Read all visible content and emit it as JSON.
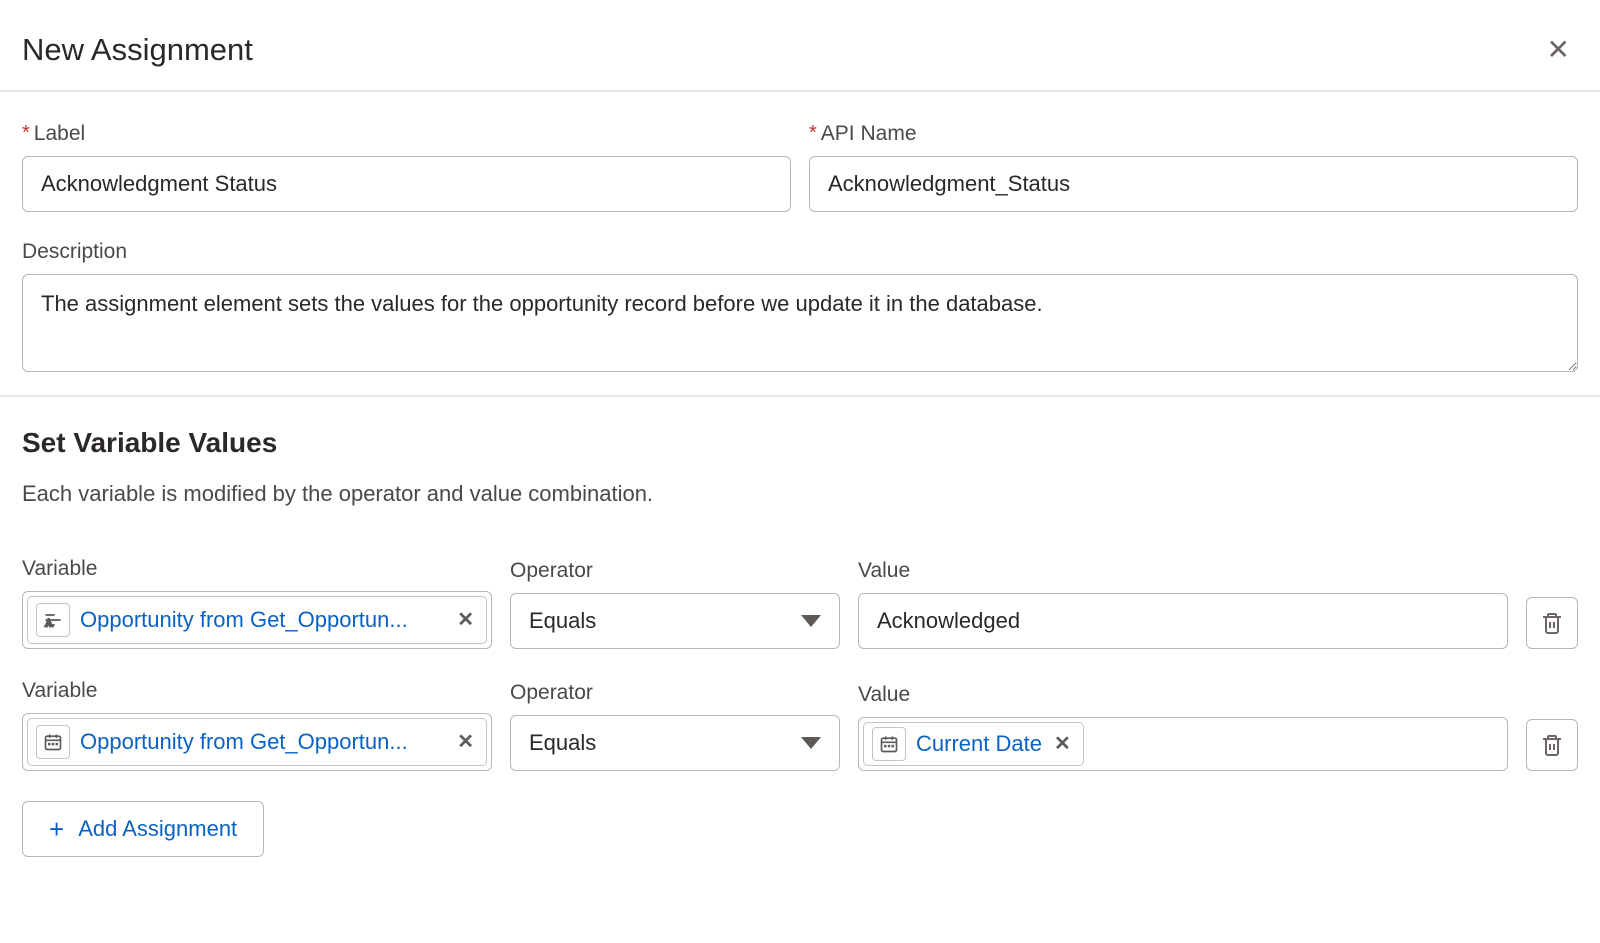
{
  "header": {
    "title": "New Assignment"
  },
  "fields": {
    "label_field": {
      "label": "Label",
      "value": "Acknowledgment Status"
    },
    "api_name_field": {
      "label": "API Name",
      "value": "Acknowledgment_Status"
    },
    "description_field": {
      "label": "Description",
      "value": "The assignment element sets the values for the opportunity record before we update it in the database."
    }
  },
  "section": {
    "title": "Set Variable Values",
    "help": "Each variable is modified by the operator and value combination."
  },
  "column_headers": {
    "variable": "Variable",
    "operator": "Operator",
    "value": "Value"
  },
  "rows": [
    {
      "variable_pill": "Opportunity from Get_Opportun...",
      "variable_icon": "text",
      "operator": "Equals",
      "value_type": "text",
      "value_text": "Acknowledged"
    },
    {
      "variable_pill": "Opportunity from Get_Opportun...",
      "variable_icon": "date",
      "operator": "Equals",
      "value_type": "pill",
      "value_pill_label": "Current Date",
      "value_pill_icon": "date"
    }
  ],
  "add_button": "Add Assignment"
}
